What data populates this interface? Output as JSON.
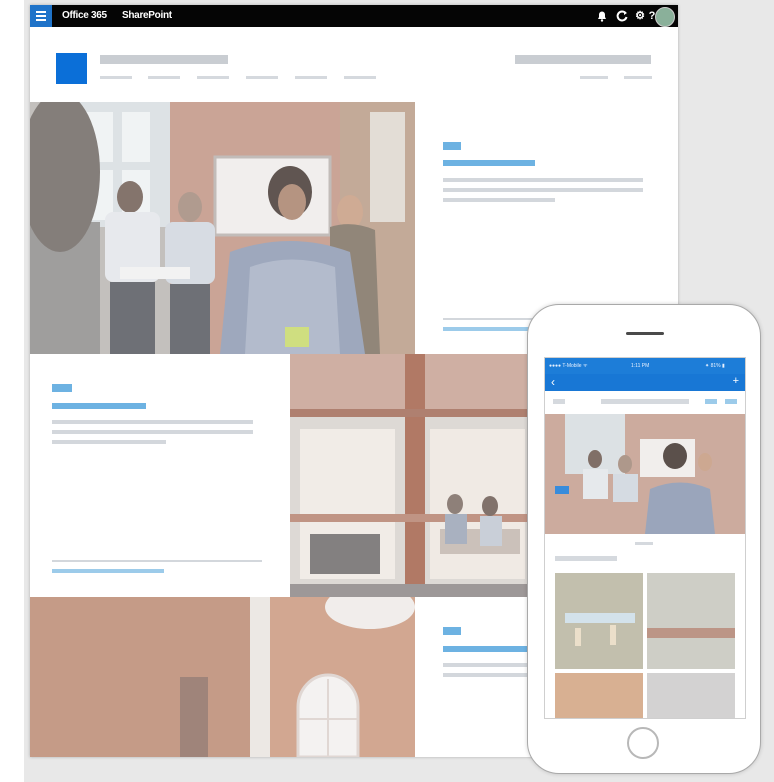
{
  "suite_bar": {
    "app_name": "Office 365",
    "product_name": "SharePoint",
    "icons": [
      "app-launcher-icon",
      "notification-icon",
      "refresh-icon",
      "settings-icon",
      "help-icon",
      "avatar-icon"
    ],
    "settings_glyph": "⚙",
    "help_glyph": "?",
    "accent_color": "#1f73c9"
  },
  "site": {
    "logo_color": "#0b6fd8",
    "nav_items_count_hint": "placeholder"
  },
  "phone": {
    "status_carrier": "●●●● T-Mobile ᯤ",
    "status_time": "1:11 PM",
    "status_battery": "⁕ 81% ▮",
    "back_glyph": "‹",
    "plus_glyph": "+"
  },
  "colors": {
    "suite_bar": "#050505",
    "phone_bar": "#1877d5",
    "placeholder_blue": "#9ccbea",
    "placeholder_gray": "#d5d9de"
  }
}
